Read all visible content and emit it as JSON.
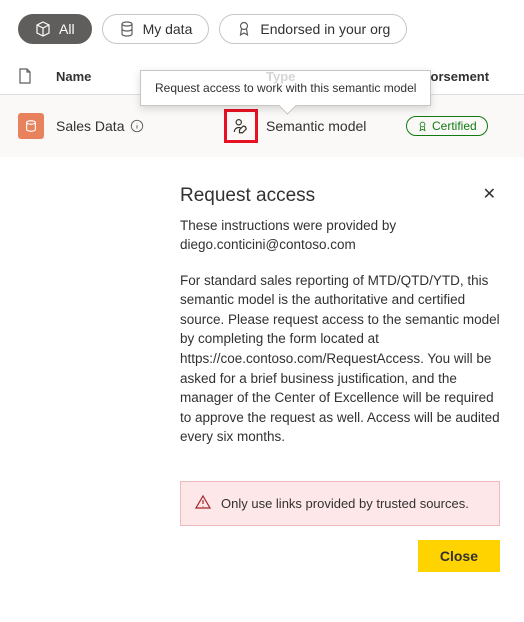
{
  "filters": {
    "all": "All",
    "mydata": "My data",
    "endorsed": "Endorsed in your org"
  },
  "columns": {
    "name": "Name",
    "type": "Type",
    "endorsement": "Endorsement"
  },
  "tooltip": "Request access to work with this semantic model",
  "row": {
    "name": "Sales Data",
    "type": "Semantic model",
    "badge": "Certified"
  },
  "dialog": {
    "title": "Request access",
    "intro": "These instructions were provided by diego.conticini@contoso.com",
    "body": "For standard sales reporting of MTD/QTD/YTD, this semantic model is the authoritative and certified source. Please request access to the semantic model by completing the form located at https://coe.contoso.com/RequestAccess. You will be asked for a brief business justification, and the manager of the Center of Excellence will be required to approve the request as well. Access will be audited every six months.",
    "warning": "Only use links provided by trusted sources.",
    "close": "Close"
  }
}
